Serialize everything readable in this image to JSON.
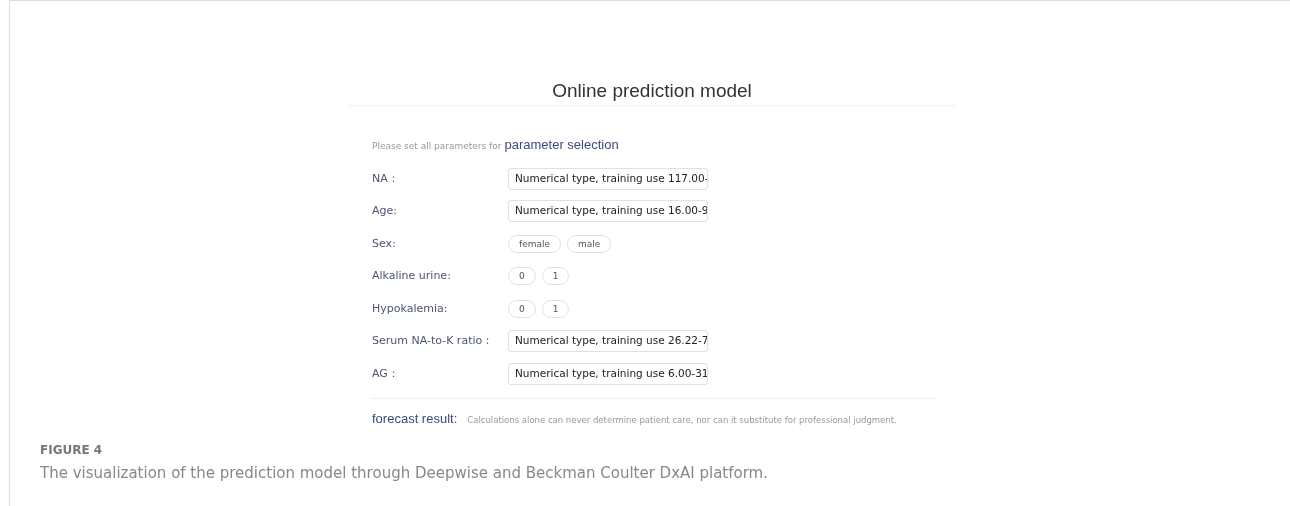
{
  "title": "Online prediction model",
  "intro": {
    "hint": "Please set all parameters for",
    "heading": "parameter selection"
  },
  "parameters": [
    {
      "label": "NA：",
      "kind": "input",
      "value": "Numerical type, training use 117.00-"
    },
    {
      "label": "Age:",
      "kind": "input",
      "value": "Numerical type, training use 16.00-9"
    },
    {
      "label": "Sex:",
      "kind": "choice",
      "options": [
        {
          "label": "female",
          "selected": false
        },
        {
          "label": "male",
          "selected": false
        }
      ]
    },
    {
      "label": "Alkaline urine:",
      "kind": "choice",
      "options": [
        {
          "label": "0",
          "selected": false
        },
        {
          "label": "1",
          "selected": false
        }
      ]
    },
    {
      "label": "Hypokalemia:",
      "kind": "choice",
      "options": [
        {
          "label": "0",
          "selected": false
        },
        {
          "label": "1",
          "selected": false
        }
      ]
    },
    {
      "label": "Serum NA-to-K ratio：",
      "kind": "input",
      "value": "Numerical type, training use 26.22-7"
    },
    {
      "label": "AG：",
      "kind": "input",
      "value": "Numerical type, training use 6.00-31"
    }
  ],
  "result": {
    "label": "forecast result:",
    "disclaimer": "Calculations alone can never determine patient care, nor can it substitute for professional judgment."
  },
  "figure": {
    "number": "FIGURE 4",
    "caption": "The visualization of the prediction model through Deepwise and Beckman Coulter DxAI platform."
  }
}
